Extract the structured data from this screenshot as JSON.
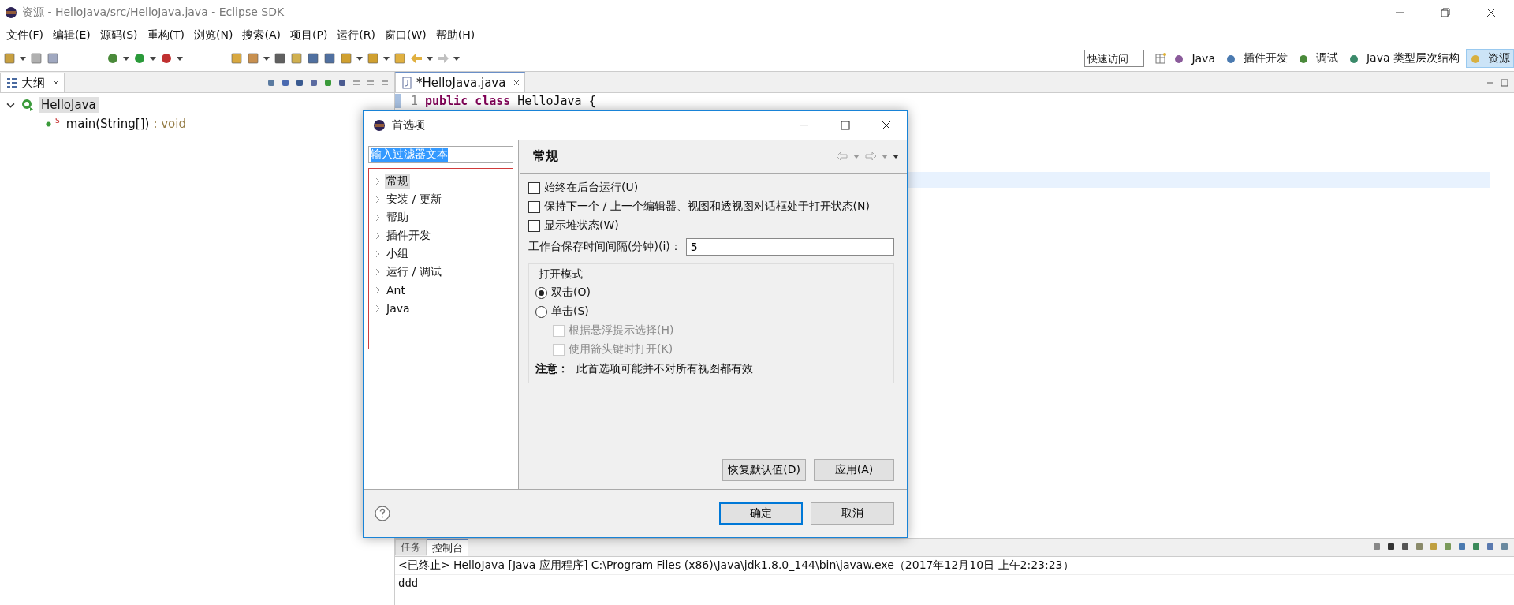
{
  "window": {
    "title": "资源 - HelloJava/src/HelloJava.java - Eclipse SDK"
  },
  "menu": [
    "文件(F)",
    "编辑(E)",
    "源码(S)",
    "重构(T)",
    "浏览(N)",
    "搜索(A)",
    "项目(P)",
    "运行(R)",
    "窗口(W)",
    "帮助(H)"
  ],
  "quick_access": {
    "placeholder": "快速访问"
  },
  "perspectives": [
    {
      "label": "Java",
      "selected": false
    },
    {
      "label": "插件开发",
      "selected": false
    },
    {
      "label": "调试",
      "selected": false
    },
    {
      "label": "Java 类型层次结构",
      "selected": false
    },
    {
      "label": "资源",
      "selected": true
    }
  ],
  "outline": {
    "title": "大纲",
    "tree": [
      {
        "label": "HelloJava",
        "expanded": true,
        "selected": true,
        "children": [
          {
            "label": "main(String[])",
            "modifier": "S",
            "return_type": " : void"
          }
        ]
      }
    ]
  },
  "editor": {
    "tab": "*HelloJava.java",
    "lines": [
      {
        "number": "1",
        "tokens": [
          {
            "text": "public",
            "kind": "keyword"
          },
          {
            "text": "class",
            "kind": "keyword"
          },
          {
            "text": "HelloJava {",
            "kind": "plain"
          }
        ]
      }
    ]
  },
  "dialog": {
    "title": "首选项",
    "filter": {
      "value": "输入过滤器文本"
    },
    "nav": [
      {
        "label": "常规",
        "selected": true
      },
      {
        "label": "安装 / 更新",
        "selected": false
      },
      {
        "label": "帮助",
        "selected": false
      },
      {
        "label": "插件开发",
        "selected": false
      },
      {
        "label": "小组",
        "selected": false
      },
      {
        "label": "运行 / 调试",
        "selected": false
      },
      {
        "label": "Ant",
        "selected": false
      },
      {
        "label": "Java",
        "selected": false
      }
    ],
    "page_title": "常规",
    "checkboxes": [
      {
        "label": "始终在后台运行(U)",
        "checked": false
      },
      {
        "label": "保持下一个 / 上一个编辑器、视图和透视图对话框处于打开状态(N)",
        "checked": false
      },
      {
        "label": "显示堆状态(W)",
        "checked": false
      }
    ],
    "save_interval": {
      "label": "工作台保存时间间隔(分钟)(i)：",
      "value": "5"
    },
    "open_mode": {
      "title": "打开模式",
      "radios": [
        {
          "label": "双击(O)",
          "selected": true
        },
        {
          "label": "单击(S)",
          "selected": false
        }
      ],
      "sub_options": [
        {
          "label": "根据悬浮提示选择(H)",
          "checked": false,
          "disabled": true
        },
        {
          "label": "使用箭头键时打开(K)",
          "checked": false,
          "disabled": true
        }
      ],
      "note": {
        "label": "注意：",
        "text": "此首选项可能并不对所有视图都有效"
      }
    },
    "page_buttons": [
      "恢复默认值(D)",
      "应用(A)"
    ],
    "buttons": [
      {
        "label": "确定",
        "default": true
      },
      {
        "label": "取消",
        "default": false
      }
    ]
  },
  "console": {
    "tabs": [
      {
        "label": "任务",
        "selected": false
      },
      {
        "label": "控制台",
        "selected": true
      }
    ],
    "header": "<已终止> HelloJava [Java 应用程序] C:\\Program Files (x86)\\Java\\jdk1.8.0_144\\bin\\javaw.exe（2017年12月10日 上午2:23:23）",
    "lines": [
      "ddd"
    ]
  }
}
